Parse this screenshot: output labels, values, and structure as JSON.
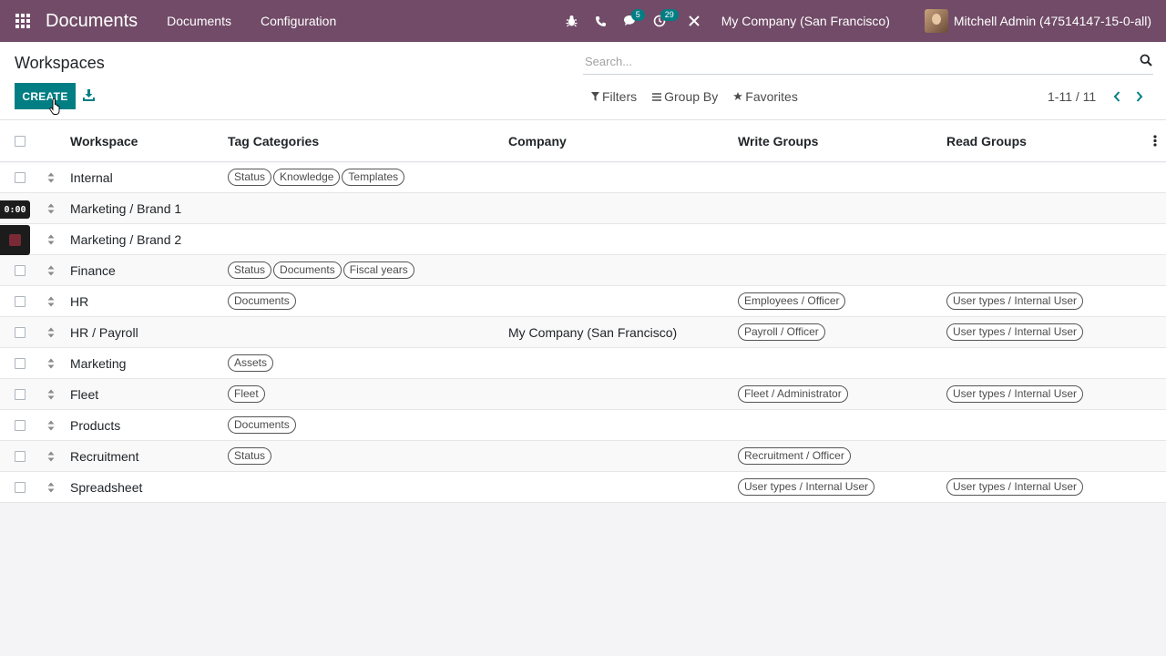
{
  "navbar": {
    "brand": "Documents",
    "menus": [
      "Documents",
      "Configuration"
    ],
    "messages_badge": "5",
    "activities_badge": "29",
    "company": "My Company (San Francisco)",
    "user": "Mitchell Admin (47514147-15-0-all)"
  },
  "control": {
    "title": "Workspaces",
    "create_label": "CREATE",
    "search_placeholder": "Search...",
    "filters_label": "Filters",
    "groupby_label": "Group By",
    "favorites_label": "Favorites",
    "pager": "1-11 / 11"
  },
  "table": {
    "headers": {
      "workspace": "Workspace",
      "tags": "Tag Categories",
      "company": "Company",
      "write": "Write Groups",
      "read": "Read Groups"
    },
    "rows": [
      {
        "workspace": "Internal",
        "tags": [
          "Status",
          "Knowledge",
          "Templates"
        ],
        "company": "",
        "write": "",
        "read": ""
      },
      {
        "workspace": "Marketing / Brand 1",
        "tags": [],
        "company": "",
        "write": "",
        "read": ""
      },
      {
        "workspace": "Marketing / Brand 2",
        "tags": [],
        "company": "",
        "write": "",
        "read": ""
      },
      {
        "workspace": "Finance",
        "tags": [
          "Status",
          "Documents",
          "Fiscal years"
        ],
        "company": "",
        "write": "",
        "read": ""
      },
      {
        "workspace": "HR",
        "tags": [
          "Documents"
        ],
        "company": "",
        "write": "Employees / Officer",
        "read": "User types / Internal User"
      },
      {
        "workspace": "HR / Payroll",
        "tags": [],
        "company": "My Company (San Francisco)",
        "write": "Payroll / Officer",
        "read": "User types / Internal User"
      },
      {
        "workspace": "Marketing",
        "tags": [
          "Assets"
        ],
        "company": "",
        "write": "",
        "read": ""
      },
      {
        "workspace": "Fleet",
        "tags": [
          "Fleet"
        ],
        "company": "",
        "write": "Fleet / Administrator",
        "read": "User types / Internal User"
      },
      {
        "workspace": "Products",
        "tags": [
          "Documents"
        ],
        "company": "",
        "write": "",
        "read": ""
      },
      {
        "workspace": "Recruitment",
        "tags": [
          "Status"
        ],
        "company": "",
        "write": "Recruitment / Officer",
        "read": ""
      },
      {
        "workspace": "Spreadsheet",
        "tags": [],
        "company": "",
        "write": "User types / Internal User",
        "read": "User types / Internal User"
      }
    ]
  },
  "recorder": {
    "time": "0:00"
  },
  "colors": {
    "navbar": "#714b67",
    "primary": "#017e84",
    "badge": "#017e84"
  }
}
